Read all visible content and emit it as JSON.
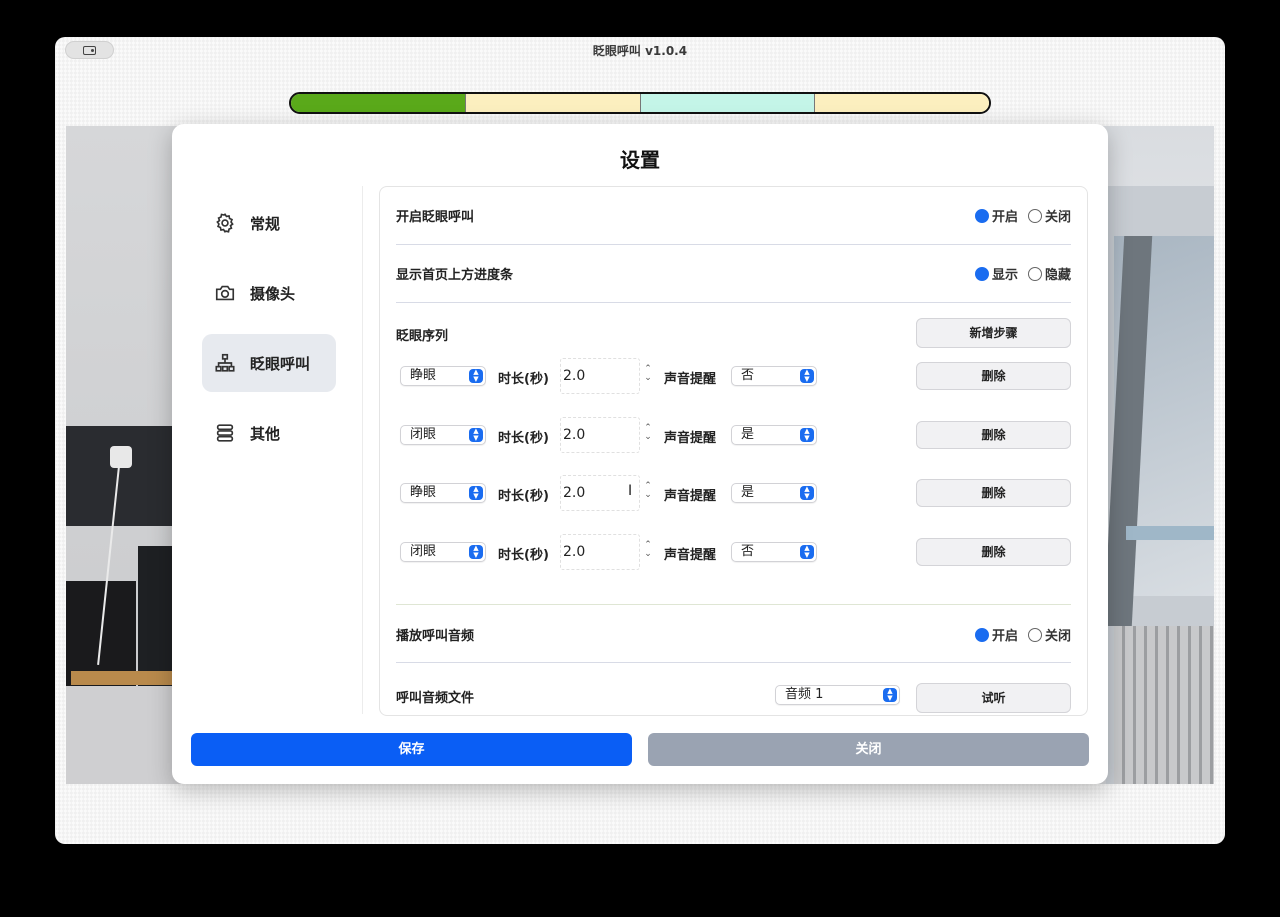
{
  "window": {
    "title": "眨眼呼叫 v1.0.4"
  },
  "progress_bar": {
    "segments": [
      {
        "color": "#5aa91a"
      },
      {
        "color": "#fcefbf"
      },
      {
        "color": "#c4f5e8"
      },
      {
        "color": "#fcefbf"
      }
    ]
  },
  "dialog": {
    "title": "设置",
    "nav": [
      {
        "label": "常规",
        "icon": "gear-icon",
        "active": false
      },
      {
        "label": "摄像头",
        "icon": "camera-icon",
        "active": false
      },
      {
        "label": "眨眼呼叫",
        "icon": "hierarchy-icon",
        "active": true
      },
      {
        "label": "其他",
        "icon": "stack-icon",
        "active": false
      }
    ],
    "settings": {
      "enable": {
        "label": "开启眨眼呼叫",
        "on_label": "开启",
        "off_label": "关闭",
        "value": "on"
      },
      "progress": {
        "label": "显示首页上方进度条",
        "on_label": "显示",
        "off_label": "隐藏",
        "value": "on"
      },
      "sequence": {
        "label": "眨眼序列",
        "add_button": "新增步骤",
        "duration_label": "时长(秒)",
        "sound_label": "声音提醒",
        "delete_button": "删除",
        "steps": [
          {
            "state": "睁眼",
            "duration": "2.0",
            "sound": "否"
          },
          {
            "state": "闭眼",
            "duration": "2.0",
            "sound": "是"
          },
          {
            "state": "睁眼",
            "duration": "2.0",
            "sound": "是"
          },
          {
            "state": "闭眼",
            "duration": "2.0",
            "sound": "否"
          }
        ]
      },
      "play_audio": {
        "label": "播放呼叫音频",
        "on_label": "开启",
        "off_label": "关闭",
        "value": "on"
      },
      "audio_file": {
        "label": "呼叫音频文件",
        "selected": "音频 1",
        "preview_button": "试听"
      }
    },
    "footer": {
      "save_label": "保存",
      "close_label": "关闭"
    },
    "colors": {
      "primary": "#0a5ef5",
      "secondary": "#9aa3b2",
      "accent": "#1a6cf0"
    }
  }
}
